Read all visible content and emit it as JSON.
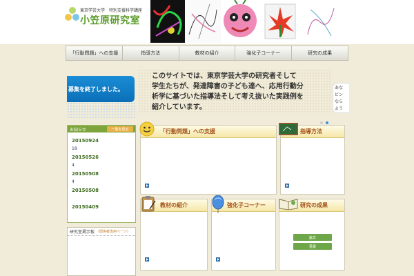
{
  "header": {
    "sub_title": "東京学芸大学　特別支援科学講座",
    "title": "小笠原研究室"
  },
  "nav": {
    "items": [
      {
        "label": "「行動問題」への支援"
      },
      {
        "label": "指導方法"
      },
      {
        "label": "教材の紹介"
      },
      {
        "label": "強化子コーナー"
      },
      {
        "label": "研究の成果"
      }
    ]
  },
  "hero": {
    "left_banner": "募集を終了しました。",
    "lines": [
      "このサイトでは、東京学芸大学の研究者そして",
      "学生たちが、発達障害の子ども達へ、応用行動分",
      "析学に基づいた指導法そして考え抜いた実践例を",
      "紹介しています。"
    ],
    "right_lines": [
      "あな",
      "ビン",
      "なら",
      "よう"
    ]
  },
  "sidebar": {
    "head": "お知らせ",
    "tag": "一覧を見る",
    "items": [
      {
        "date": "20150924",
        "count": "18"
      },
      {
        "date": "20150526",
        "count": "4"
      },
      {
        "date": "20150508",
        "count": "4"
      },
      {
        "date": "20150508",
        "count": ""
      },
      {
        "date": "20150409",
        "count": ""
      }
    ]
  },
  "board": {
    "head": "研究室掲示板",
    "sub": "（関係者専用ページ）"
  },
  "cards": {
    "behavior": "「行動問題」への支援",
    "teaching": "指導方法",
    "materials": "教材の紹介",
    "reinforcer": "強化子コーナー",
    "results": "研究の成果",
    "btn_paper": "論文",
    "btn_book": "著書"
  },
  "colors": {
    "background": "#f1ecd9",
    "accent_green": "#5c9c2c",
    "banner_blue": "#0b6fb8",
    "card_title": "#a4541a"
  }
}
